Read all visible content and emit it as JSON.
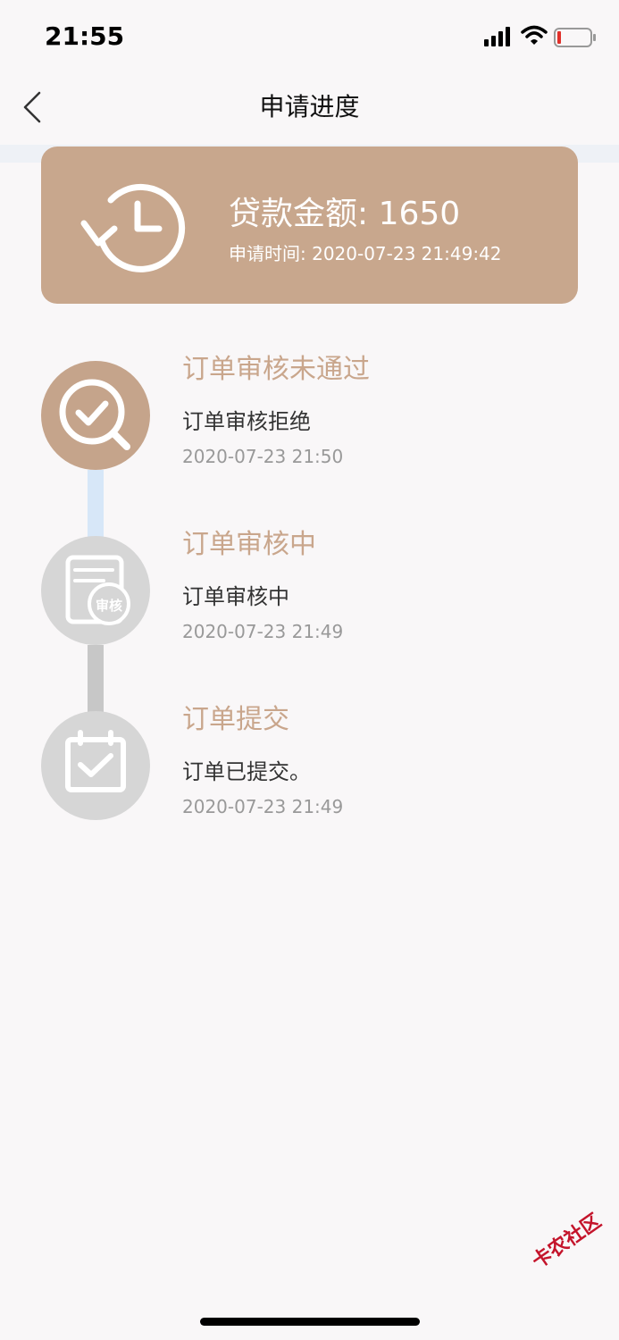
{
  "status_bar": {
    "time": "21:55"
  },
  "nav": {
    "title": "申请进度"
  },
  "summary": {
    "amount_label": "贷款金额: 1650",
    "time_label": "申请时间: 2020-07-23 21:49:42"
  },
  "steps": [
    {
      "title": "订单审核未通过",
      "desc": "订单审核拒绝",
      "date": "2020-07-23 21:50",
      "icon": "search-check-icon",
      "state": "active"
    },
    {
      "title": "订单审核中",
      "desc": "订单审核中",
      "date": "2020-07-23 21:49",
      "icon": "review-document-icon",
      "badge": "审核",
      "state": "inactive"
    },
    {
      "title": "订单提交",
      "desc": "订单已提交。",
      "date": "2020-07-23 21:49",
      "icon": "calendar-check-icon",
      "state": "inactive"
    }
  ],
  "colors": {
    "accent": "#c8a78d",
    "title_text": "#c9a68c",
    "inactive": "#d6d6d6",
    "connector_active": "#d7e7f8",
    "connector_inactive": "#c7c7c7"
  },
  "watermark": {
    "text": "卡农社区"
  }
}
